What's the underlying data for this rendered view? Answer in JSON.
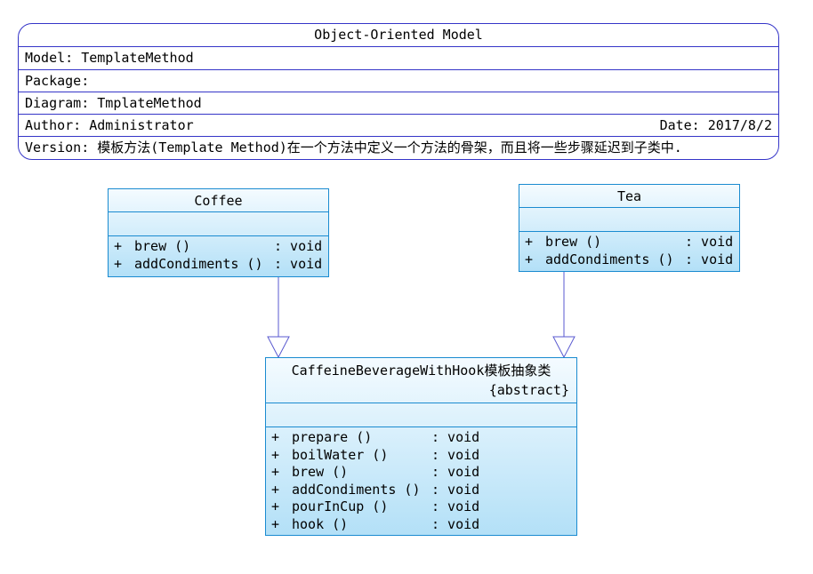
{
  "header": {
    "title": "Object-Oriented Model",
    "model": "Model: TemplateMethod",
    "package": "Package:",
    "diagram": "Diagram: TmplateMethod",
    "author": "Author: Administrator",
    "date": "Date: 2017/8/2",
    "version": "Version: 模板方法(Template Method)在一个方法中定义一个方法的骨架，而且将一些步骤延迟到子类中."
  },
  "classes": {
    "coffee": {
      "name": "Coffee",
      "operations": [
        {
          "vis": "+",
          "name": "brew ()",
          "ret": ": void"
        },
        {
          "vis": "+",
          "name": "addCondiments ()",
          "ret": ": void"
        }
      ]
    },
    "tea": {
      "name": "Tea",
      "operations": [
        {
          "vis": "+",
          "name": "brew ()",
          "ret": ": void"
        },
        {
          "vis": "+",
          "name": "addCondiments ()",
          "ret": ": void"
        }
      ]
    },
    "abstract": {
      "name": "CaffeineBeverageWithHook模板抽象类",
      "stereotype": "{abstract}",
      "operations": [
        {
          "vis": "+",
          "name": "prepare ()",
          "ret": ": void"
        },
        {
          "vis": "+",
          "name": "boilWater ()",
          "ret": ": void"
        },
        {
          "vis": "+",
          "name": "brew ()",
          "ret": ": void"
        },
        {
          "vis": "+",
          "name": "addCondiments ()",
          "ret": ": void"
        },
        {
          "vis": "+",
          "name": "pourInCup ()",
          "ret": ": void"
        },
        {
          "vis": "+",
          "name": "hook ()",
          "ret": ": void"
        }
      ]
    }
  },
  "relations": [
    {
      "type": "generalization",
      "from": "Coffee",
      "to": "CaffeineBeverageWithHook模板抽象类"
    },
    {
      "type": "generalization",
      "from": "Tea",
      "to": "CaffeineBeverageWithHook模板抽象类"
    }
  ],
  "colors": {
    "border": "#3535c8",
    "class_border": "#1a8bd0",
    "class_fill_top": "#f4fbff",
    "class_fill_bottom": "#b3e0f7",
    "link": "#5a5ad0"
  }
}
